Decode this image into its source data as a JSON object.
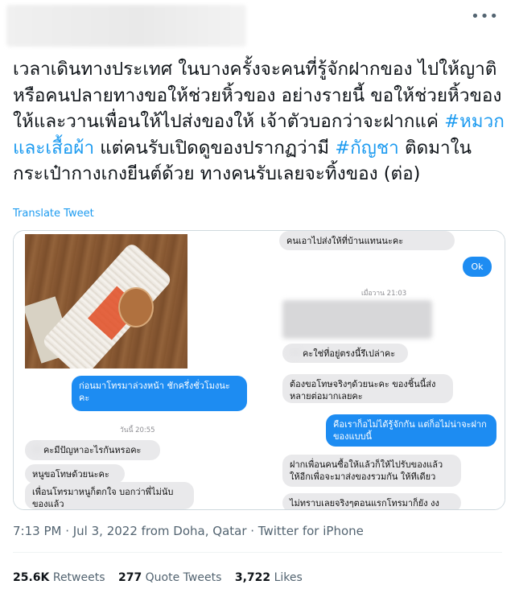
{
  "tweet": {
    "text_parts": {
      "p1": "เวลาเดินทางประเทศ ในบางครั้งจะคนที่รู้จักฝากของ ไปให้ญาติ หรือคนปลายทางขอให้ช่วยหิ้วของ อย่างรายนี้ ขอให้ช่วยหิ้วของให้และวานเพื่อนให้ไปส่งของให้ เจ้าตัวบอกว่าจะฝากแค่ ",
      "h1": "#หมวกและเสื้อผ้า",
      "p2": " แต่คนรับเปิดดูของปรากฏว่ามี ",
      "h2": "#กัญชา",
      "p3": " ติดมาในกระเป๋ากางเกงยีนต์ด้วย ทางคนรับเลยจะทิ้งของ (ต่อ)"
    },
    "translate_label": "Translate Tweet",
    "more_icon": "•••",
    "meta": "7:13 PM · Jul 3, 2022 from Doha, Qatar · Twitter for iPhone",
    "stats": {
      "retweets_count": "25.6K",
      "retweets_label": "Retweets",
      "quotes_count": "277",
      "quotes_label": "Quote Tweets",
      "likes_count": "3,722",
      "likes_label": "Likes"
    }
  },
  "chat_left": {
    "msg_out_1": "ก่อนมาโทรมาล่วงหน้า ชักครึ่งชั่วโมงนะ",
    "msg_out_1b": "คะ",
    "timestamp": "วันนี้ 20:55",
    "msg_in_1": "คะมีปัญหาอะไรกันหรอคะ",
    "msg_in_2": "หนูขอโทษด้วยนะคะ",
    "msg_in_3": "เพื่อนโทรมาหนูก็ตกใจ บอกว่าพี่ไม่นับ",
    "msg_in_3b": "ของแล้ว"
  },
  "chat_right": {
    "msg_in_top": "คนเอาไปส่งให้ที่บ้านแทนนะคะ",
    "msg_out_ok": "Ok",
    "timestamp": "เมื่อวาน 21:03",
    "msg_in_2": "คะใช่ที่อยู่ตรงนี้รึเปล่าคะ",
    "msg_in_3": "ต้องขอโทษจริงๆด้วยนะคะ ของชิ้นนี้ส่ง",
    "msg_in_3b": "หลายต่อมากเลยคะ",
    "msg_out_2": "คือเราก็อไม่ได้รู้จักกัน แต่ก็อไม่น่าจะฝาก",
    "msg_out_2b": "ของแบบนี้",
    "msg_in_4": "ฝากเพื่อนคนซื้อให้แล้วก็ให้ไปรับของแล้ว",
    "msg_in_4b": "ให้อีกเพื่อจะมาส่งของรวมกัน ให้ทีเดียว",
    "msg_in_5": "ไม่ทราบเลยจริงๆตอนแรกโทรมาก็ยัง งง"
  }
}
